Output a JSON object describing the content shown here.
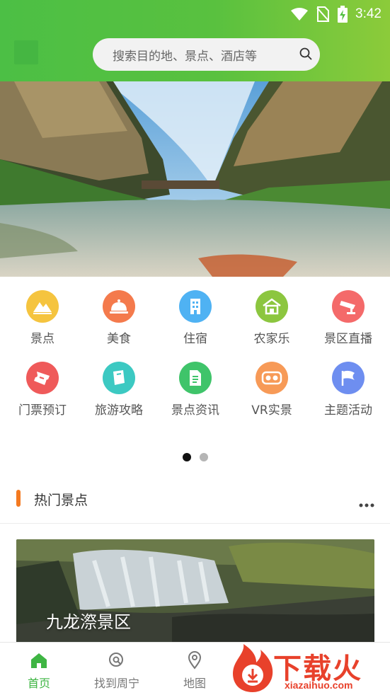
{
  "status_bar": {
    "time": "3:42"
  },
  "search": {
    "placeholder": "搜索目的地、景点、酒店等"
  },
  "categories": {
    "row1": [
      {
        "label": "景点",
        "icon": "scenic-mountain-icon",
        "color": "#f5c43f"
      },
      {
        "label": "美食",
        "icon": "food-dome-icon",
        "color": "#f47a4c"
      },
      {
        "label": "住宿",
        "icon": "hotel-building-icon",
        "color": "#4fb2f3"
      },
      {
        "label": "农家乐",
        "icon": "farmhouse-icon",
        "color": "#8cc63f"
      },
      {
        "label": "景区直播",
        "icon": "camera-icon",
        "color": "#f46a6a"
      }
    ],
    "row2": [
      {
        "label": "门票预订",
        "icon": "ticket-icon",
        "color": "#ef5a5a"
      },
      {
        "label": "旅游攻略",
        "icon": "guidebook-icon",
        "color": "#3cc9c2"
      },
      {
        "label": "景点资讯",
        "icon": "news-document-icon",
        "color": "#3fc46a"
      },
      {
        "label": "VR实景",
        "icon": "vr-goggles-icon",
        "color": "#f79a57"
      },
      {
        "label": "主题活动",
        "icon": "flag-icon",
        "color": "#6e8ef0"
      }
    ]
  },
  "hot_section": {
    "title": "热门景点"
  },
  "hot_spots": [
    {
      "name": "九龙漈景区"
    }
  ],
  "tabbar": {
    "items": [
      {
        "label": "首页",
        "active": true
      },
      {
        "label": "找到周宁",
        "active": false
      },
      {
        "label": "地图",
        "active": false
      }
    ]
  },
  "watermark": {
    "text": "下载火",
    "url": "xiazaihuo.com"
  },
  "colors": {
    "brand_green": "#4cbf45",
    "accent_orange": "#f47a20",
    "watermark_red": "#e8412b"
  }
}
